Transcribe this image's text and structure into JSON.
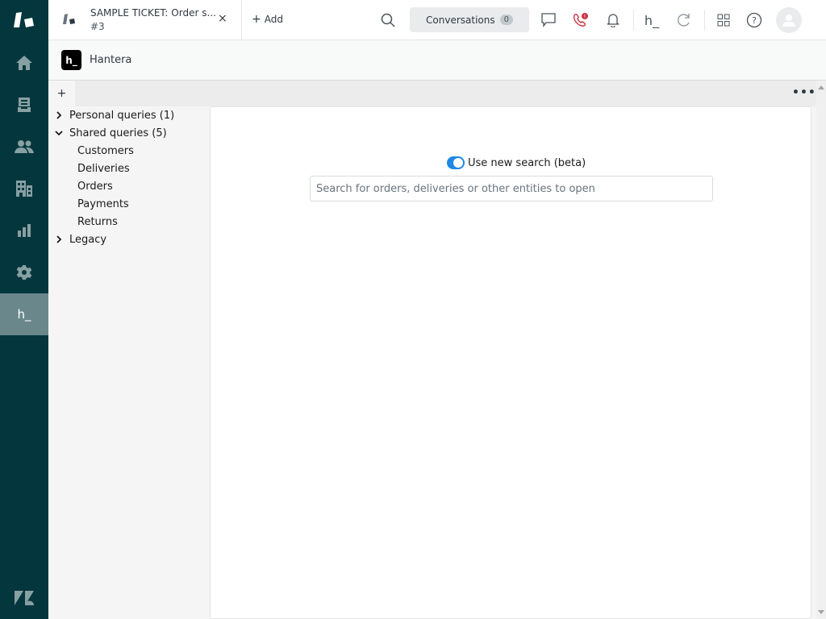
{
  "rail": {
    "items": [
      {
        "name": "zendesk-logo",
        "icon": "zendesk-logo-icon"
      },
      {
        "name": "home",
        "icon": "home-icon"
      },
      {
        "name": "views",
        "icon": "inbox-icon"
      },
      {
        "name": "customers",
        "icon": "users-icon"
      },
      {
        "name": "organizations",
        "icon": "building-icon"
      },
      {
        "name": "reporting",
        "icon": "bar-chart-icon"
      },
      {
        "name": "admin",
        "icon": "gear-icon"
      },
      {
        "name": "hantera-app",
        "icon": "hantera-icon",
        "label": "h_",
        "active": true
      }
    ],
    "bottom_logo": "zendesk-icon"
  },
  "topbar": {
    "tab": {
      "title": "SAMPLE TICKET: Order s...",
      "subtitle": "#3",
      "close": "×"
    },
    "add_label": "Add",
    "add_symbol": "+",
    "conversations_label": "Conversations",
    "conversations_count": "0",
    "hantera_label": "h_",
    "call_alert_badge": "!",
    "colors": {
      "call_icon": "#cc3340",
      "rail_bg": "#03363d",
      "toggle_on": "#1e88e5"
    }
  },
  "app_header": {
    "logo_text": "h_",
    "name": "Hantera"
  },
  "workspace": {
    "add_tab_label": "+",
    "more_label": "•••",
    "tree": [
      {
        "label": "Personal queries (1)",
        "expanded": false,
        "chevron": "›"
      },
      {
        "label": "Shared queries (5)",
        "expanded": true,
        "chevron": "⌄",
        "children": [
          "Customers",
          "Deliveries",
          "Orders",
          "Payments",
          "Returns"
        ]
      },
      {
        "label": "Legacy",
        "expanded": false,
        "chevron": "›"
      }
    ],
    "search": {
      "toggle_label": "Use new search (beta)",
      "toggle_on": true,
      "placeholder": "Search for orders, deliveries or other entities to open",
      "value": ""
    }
  }
}
